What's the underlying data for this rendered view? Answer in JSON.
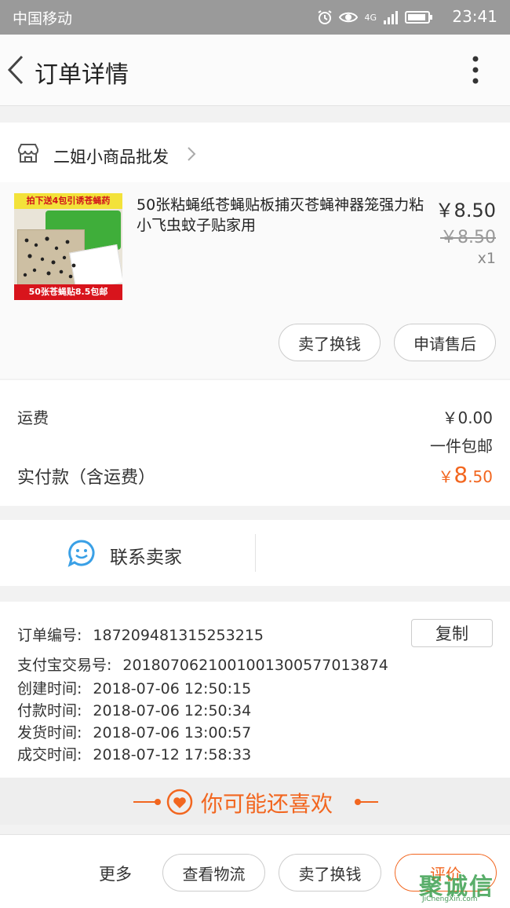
{
  "status_bar": {
    "carrier": "中国移动",
    "time": "23:41",
    "network": "4G"
  },
  "header": {
    "title": "订单详情"
  },
  "shop": {
    "name": "二姐小商品批发"
  },
  "product": {
    "image_banner_top": "拍下送4包引诱苍蝇药",
    "image_banner_bottom": "50张苍蝇贴8.5包邮",
    "title": "50张粘蝇纸苍蝇贴板捕灭苍蝇神器笼强力粘小飞虫蚊子贴家用",
    "price": "￥8.50",
    "original_price": "￥8.50",
    "quantity": "x1",
    "buttons": {
      "resell": "卖了换钱",
      "after_sale": "申请售后"
    }
  },
  "summary": {
    "shipping_label": "运费",
    "shipping_value": "￥0.00",
    "shipping_note": "一件包邮",
    "paid_label": "实付款（含运费）",
    "paid_currency": "￥",
    "paid_int": "8",
    "paid_dec": ".50"
  },
  "contact": {
    "label": "联系卖家"
  },
  "order_info": {
    "copy_label": "复制",
    "rows": [
      {
        "label": "订单编号:",
        "value": "187209481315253215"
      },
      {
        "label": "支付宝交易号:",
        "value": "2018070621001001300577013874"
      },
      {
        "label": "创建时间:",
        "value": "2018-07-06 12:50:15"
      },
      {
        "label": "付款时间:",
        "value": "2018-07-06 12:50:34"
      },
      {
        "label": "发货时间:",
        "value": "2018-07-06 13:00:57"
      },
      {
        "label": "成交时间:",
        "value": "2018-07-12 17:58:33"
      }
    ]
  },
  "recommend": {
    "label": "你可能还喜欢"
  },
  "bottom_bar": {
    "more": "更多",
    "logistics": "查看物流",
    "resell": "卖了换钱",
    "review": "评价"
  },
  "watermark": {
    "text": "聚诚信",
    "url": "JiChengXin.com"
  },
  "colors": {
    "accent": "#f2661f",
    "contact_icon": "#3aa0e6"
  }
}
